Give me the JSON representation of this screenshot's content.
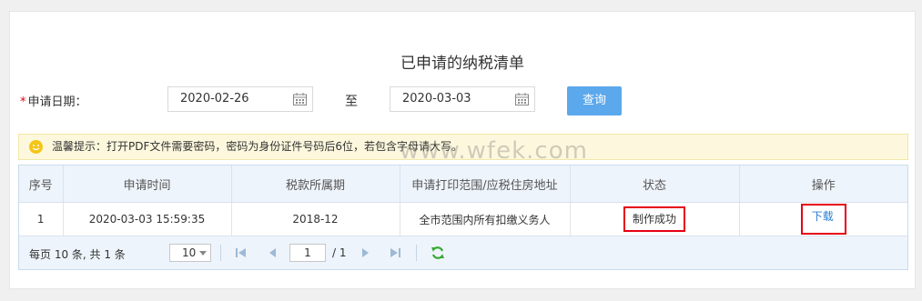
{
  "page": {
    "title": "已申请的纳税清单"
  },
  "form": {
    "required_mark": "*",
    "date_label": "申请日期：",
    "start_date": "2020-02-26",
    "to_label": "至",
    "end_date": "2020-03-03",
    "query_button": "查询"
  },
  "tip": {
    "icon": "smile-icon",
    "text": "温馨提示：打开PDF文件需要密码，密码为身份证件号码后6位，若包含字母请大写。"
  },
  "watermark": "www.wfek.com",
  "table": {
    "headers": [
      "序号",
      "申请时间",
      "税款所属期",
      "申请打印范围/应税住房地址",
      "状态",
      "操作"
    ],
    "rows": [
      {
        "index": "1",
        "apply_time": "2020-03-03 15:59:35",
        "tax_period": "2018-12",
        "scope": "全市范围内所有扣缴义务人",
        "status": "制作成功",
        "action": "下载"
      }
    ]
  },
  "pager": {
    "info": "每页 10 条, 共 1 条",
    "page_size": "10",
    "current_page": "1",
    "total_pages": "/ 1"
  },
  "colors": {
    "accent": "#5ba8ec",
    "highlight_border": "#e60012",
    "link": "#2a7fd4"
  }
}
